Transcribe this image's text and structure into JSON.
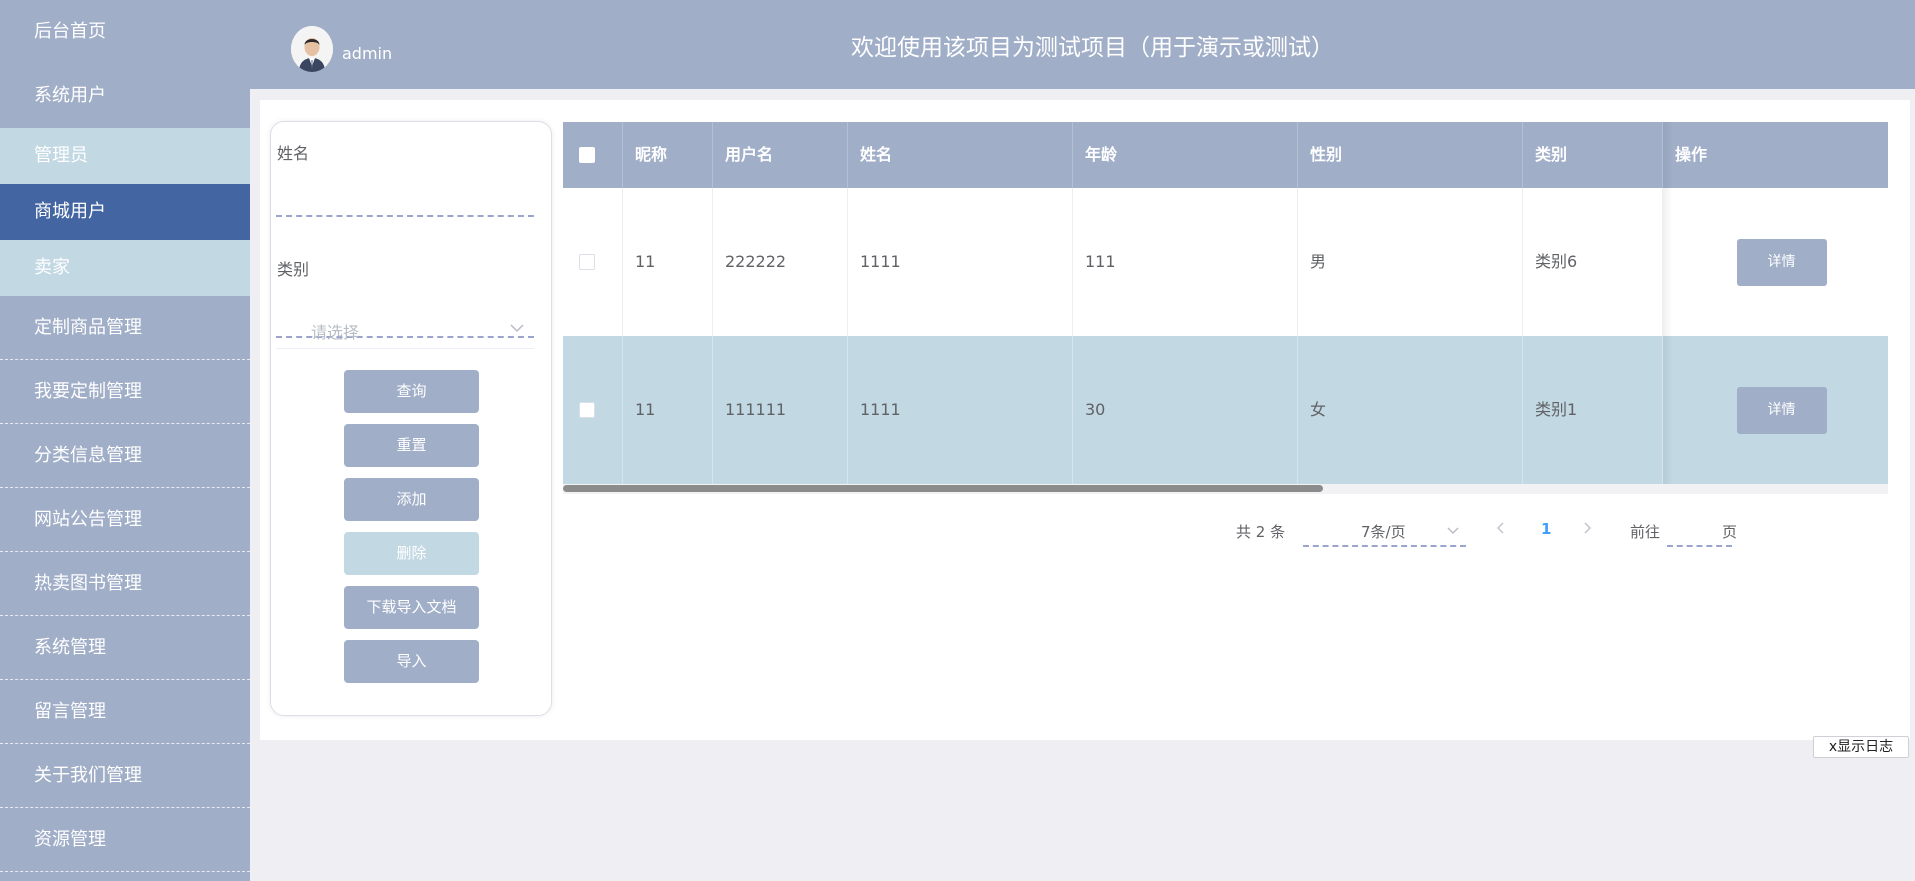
{
  "sidebar": {
    "items": [
      {
        "label": "后台首页"
      },
      {
        "label": "系统用户"
      },
      {
        "label": "管理员"
      },
      {
        "label": "商城用户"
      },
      {
        "label": "卖家"
      },
      {
        "label": "定制商品管理"
      },
      {
        "label": "我要定制管理"
      },
      {
        "label": "分类信息管理"
      },
      {
        "label": "网站公告管理"
      },
      {
        "label": "热卖图书管理"
      },
      {
        "label": "系统管理"
      },
      {
        "label": "留言管理"
      },
      {
        "label": "关于我们管理"
      },
      {
        "label": "资源管理"
      }
    ]
  },
  "header": {
    "username": "admin",
    "title": "欢迎使用该项目为测试项目（用于演示或测试）"
  },
  "search": {
    "name_label": "姓名",
    "category_label": "类别",
    "category_placeholder": "请选择",
    "buttons": {
      "query": "查询",
      "reset": "重置",
      "add": "添加",
      "delete": "删除",
      "download_template": "下载导入文档",
      "import": "导入"
    }
  },
  "table": {
    "columns": [
      "昵称",
      "用户名",
      "姓名",
      "年龄",
      "性别",
      "类别",
      "操作"
    ],
    "rows": [
      {
        "nickname": "11",
        "username": "222222",
        "name": "1111",
        "age": "111",
        "gender": "男",
        "category": "类别6",
        "action": "详情"
      },
      {
        "nickname": "11",
        "username": "111111",
        "name": "1111",
        "age": "30",
        "gender": "女",
        "category": "类别1",
        "action": "详情"
      }
    ]
  },
  "pagination": {
    "total": "共 2 条",
    "page_size": "7条/页",
    "current_page": "1",
    "goto_label": "前往",
    "page_unit": "页"
  },
  "log_toggle": "x显示日志",
  "colors": {
    "primary": "#a0aec8",
    "highlight": "#c2d8e3",
    "active": "#4366a3"
  }
}
